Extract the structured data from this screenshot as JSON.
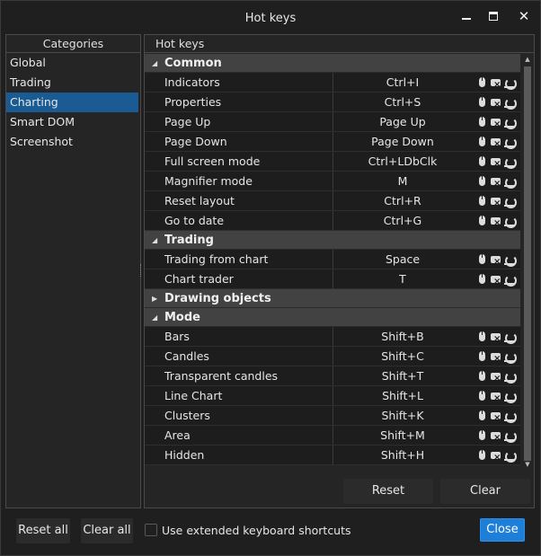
{
  "window": {
    "title": "Hot keys"
  },
  "categories": {
    "header": "Categories",
    "items": [
      {
        "label": "Global",
        "selected": false
      },
      {
        "label": "Trading",
        "selected": false
      },
      {
        "label": "Charting",
        "selected": true
      },
      {
        "label": "Smart DOM",
        "selected": false
      },
      {
        "label": "Screenshot",
        "selected": false
      }
    ]
  },
  "hotkeys": {
    "header": "Hot keys",
    "groups": [
      {
        "name": "Common",
        "expanded": true,
        "rows": [
          {
            "name": "Indicators",
            "key": "Ctrl+I"
          },
          {
            "name": "Properties",
            "key": "Ctrl+S"
          },
          {
            "name": "Page Up",
            "key": "Page Up"
          },
          {
            "name": "Page Down",
            "key": "Page Down"
          },
          {
            "name": "Full screen mode",
            "key": "Ctrl+LDbClk"
          },
          {
            "name": "Magnifier mode",
            "key": "M"
          },
          {
            "name": "Reset layout",
            "key": "Ctrl+R"
          },
          {
            "name": "Go to date",
            "key": "Ctrl+G"
          }
        ]
      },
      {
        "name": "Trading",
        "expanded": true,
        "rows": [
          {
            "name": "Trading from chart",
            "key": "Space"
          },
          {
            "name": "Chart trader",
            "key": "T"
          }
        ]
      },
      {
        "name": "Drawing objects",
        "expanded": false,
        "rows": []
      },
      {
        "name": "Mode",
        "expanded": true,
        "rows": [
          {
            "name": "Bars",
            "key": "Shift+B"
          },
          {
            "name": "Candles",
            "key": "Shift+C"
          },
          {
            "name": "Transparent candles",
            "key": "Shift+T"
          },
          {
            "name": "Line Chart",
            "key": "Shift+L"
          },
          {
            "name": "Clusters",
            "key": "Shift+K"
          },
          {
            "name": "Area",
            "key": "Shift+M"
          },
          {
            "name": "Hidden",
            "key": "Shift+H"
          }
        ]
      }
    ],
    "row_icons": [
      "mouse-icon",
      "delete-key-icon",
      "reset-key-icon"
    ]
  },
  "panel_buttons": {
    "reset": "Reset",
    "clear": "Clear"
  },
  "footer": {
    "reset_all": "Reset all",
    "clear_all": "Clear all",
    "extended_shortcuts_label": "Use extended keyboard shortcuts",
    "extended_shortcuts_checked": false,
    "close": "Close"
  },
  "colors": {
    "accent": "#1e7fd8",
    "selection": "#1a5b94",
    "group_bg": "#424242",
    "window_bg": "#1f1f1f"
  }
}
